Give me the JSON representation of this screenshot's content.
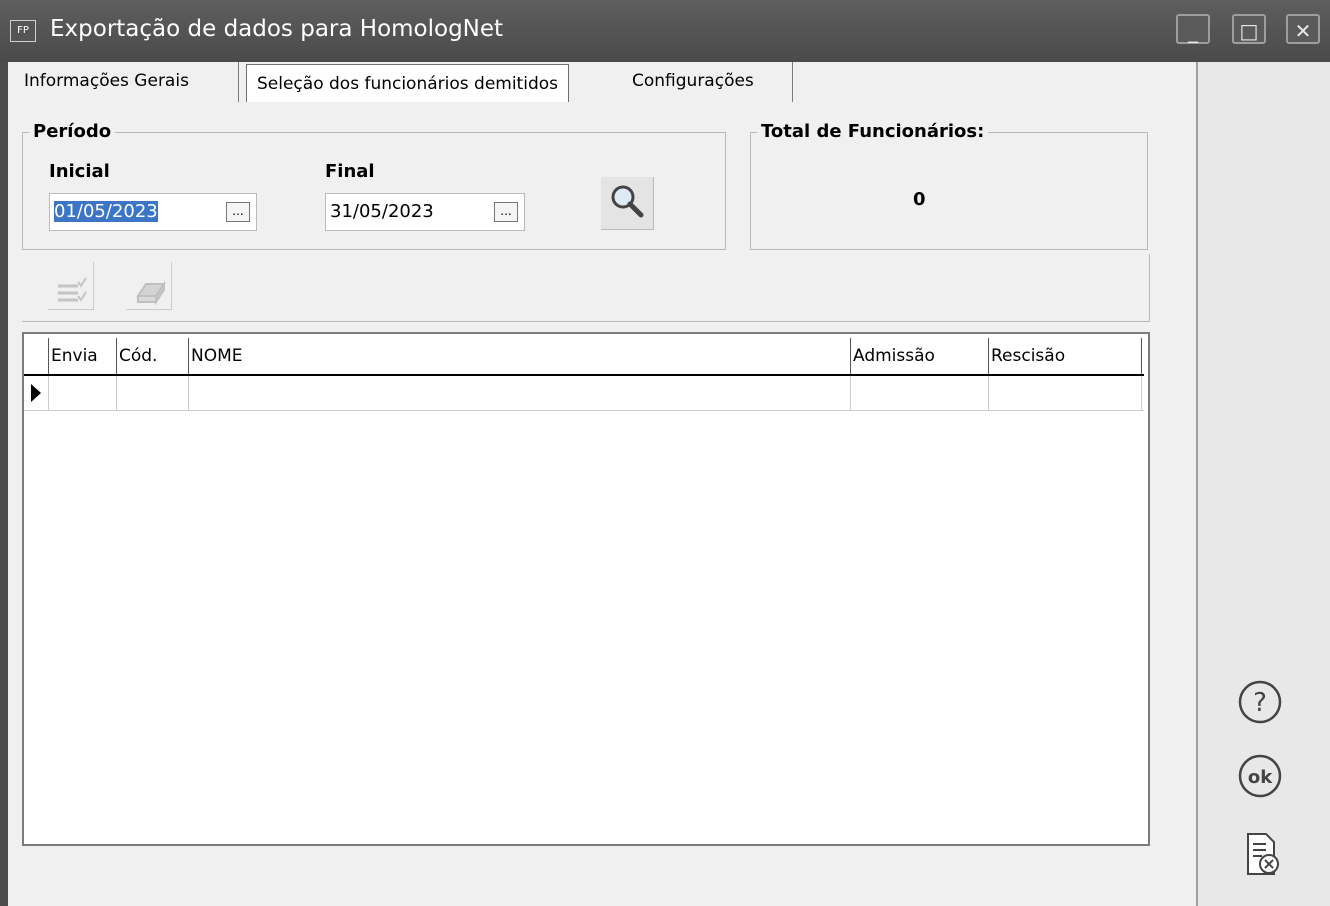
{
  "window": {
    "app_icon": "FP",
    "title": "Exportação de dados para HomologNet",
    "controls": {
      "minimize": "_",
      "maximize": "□",
      "close": "✕"
    }
  },
  "tabs": [
    {
      "label": "Informações Gerais",
      "active": false
    },
    {
      "label": "Seleção dos funcionários demitidos",
      "active": true
    },
    {
      "label": "Configurações",
      "active": false
    }
  ],
  "periodo": {
    "legend": "Período",
    "inicial_label": "Inicial",
    "inicial_value": "01/05/2023",
    "final_label": "Final",
    "final_value": "31/05/2023",
    "ellipsis": "...",
    "search_icon": "magnifier-icon"
  },
  "total": {
    "legend": "Total de Funcionários:",
    "value": "0"
  },
  "toolbar": {
    "select_all_icon": "check-list-icon",
    "clear_icon": "eraser-icon"
  },
  "table": {
    "columns": [
      "",
      "Envia",
      "Cód.",
      "NOME",
      "Admissão",
      "Rescisão"
    ],
    "rows": [
      [
        "",
        "",
        "",
        "",
        ""
      ]
    ]
  },
  "side_buttons": {
    "help_icon": "help-icon",
    "ok_icon": "ok-icon",
    "cancel_icon": "cancel-document-icon"
  }
}
